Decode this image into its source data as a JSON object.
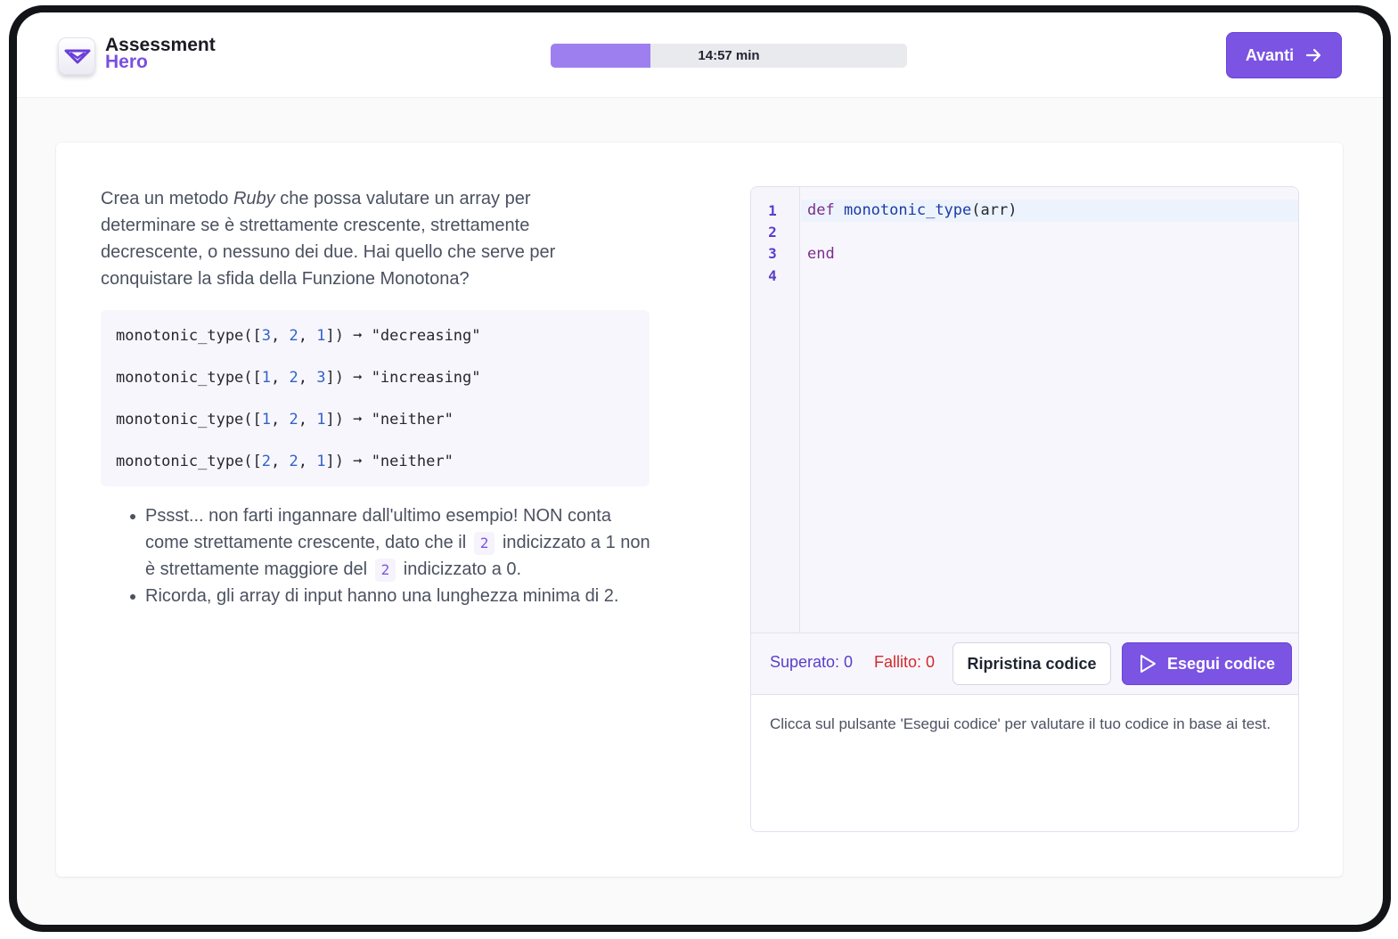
{
  "app": {
    "logo_line1": "Assessment",
    "logo_line2": "Hero",
    "accent_color": "#7b54e3"
  },
  "timer": {
    "label": "14:57 min",
    "progress_fraction": 0.28
  },
  "header": {
    "next_label": "Avanti",
    "next_icon": "arrow-right-icon"
  },
  "challenge": {
    "desc_part1": "Crea un metodo ",
    "desc_em": "Ruby",
    "desc_part2": " che possa valutare un array per determinare se è strettamente crescente, strettamente decrescente, o nessuno dei due. Hai quello che serve per conquistare la sfida della Funzione Monotona?",
    "examples": [
      {
        "call": "monotonic_type",
        "args": [
          "3",
          "2",
          "1"
        ],
        "arrow": "➞",
        "result": "\"decreasing\""
      },
      {
        "call": "monotonic_type",
        "args": [
          "1",
          "2",
          "3"
        ],
        "arrow": "➞",
        "result": "\"increasing\""
      },
      {
        "call": "monotonic_type",
        "args": [
          "1",
          "2",
          "1"
        ],
        "arrow": "➞",
        "result": "\"neither\""
      },
      {
        "call": "monotonic_type",
        "args": [
          "2",
          "2",
          "1"
        ],
        "arrow": "➞",
        "result": "\"neither\""
      }
    ],
    "tip1_a": "Pssst... non farti ingannare dall'ultimo esempio! NON conta come strettamente crescente, dato che il",
    "tip1_code1": "2",
    "tip1_b": "indicizzato a 1 non è strettamente maggiore del",
    "tip1_code2": "2",
    "tip1_c": "indicizzato a 0.",
    "tip2": "Ricorda, gli array di input hanno una lunghezza minima di 2."
  },
  "editor": {
    "line_numbers": [
      "1",
      "2",
      "3",
      "4"
    ],
    "line1_kw": "def",
    "line1_fn": "monotonic_type",
    "line1_rest": "(arr)",
    "line3_kw": "end"
  },
  "results": {
    "passed": "Superato: 0",
    "failed": "Fallito: 0",
    "reset_label": "Ripristina codice",
    "run_label": "Esegui codice",
    "run_icon": "play-icon",
    "output_text": "Clicca sul pulsante 'Esegui codice' per valutare il tuo codice in base ai test."
  }
}
